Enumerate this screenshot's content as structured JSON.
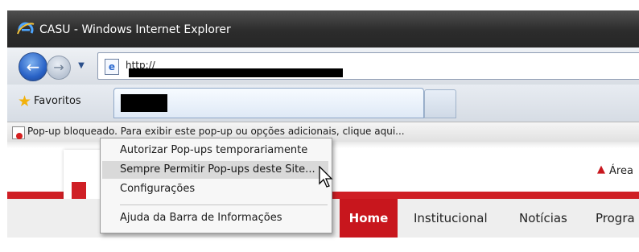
{
  "window": {
    "title": "CASU - Windows Internet Explorer"
  },
  "navigation": {
    "back_icon": "back-arrow-icon",
    "forward_icon": "forward-arrow-icon",
    "address_visible_text": "http://"
  },
  "favorites_bar": {
    "label": "Favoritos"
  },
  "info_bar": {
    "text": "Pop-up bloqueado. Para exibir este pop-up ou opções adicionais, clique aqui..."
  },
  "context_menu": {
    "items": [
      {
        "label": "Autorizar Pop-ups temporariamente"
      },
      {
        "label": "Sempre Permitir Pop-ups deste Site..."
      },
      {
        "label": "Configurações"
      },
      {
        "label": "Ajuda da Barra de Informações"
      }
    ],
    "highlighted_index": 1
  },
  "site": {
    "area_label": "Área",
    "menu": {
      "home": "Home",
      "institucional": "Institucional",
      "noticias": "Notícias",
      "programas": "Progra"
    }
  },
  "colors": {
    "brand_red": "#c8161d",
    "titlebar": "#2c2c2c",
    "menu_bg": "#eeeeee"
  }
}
